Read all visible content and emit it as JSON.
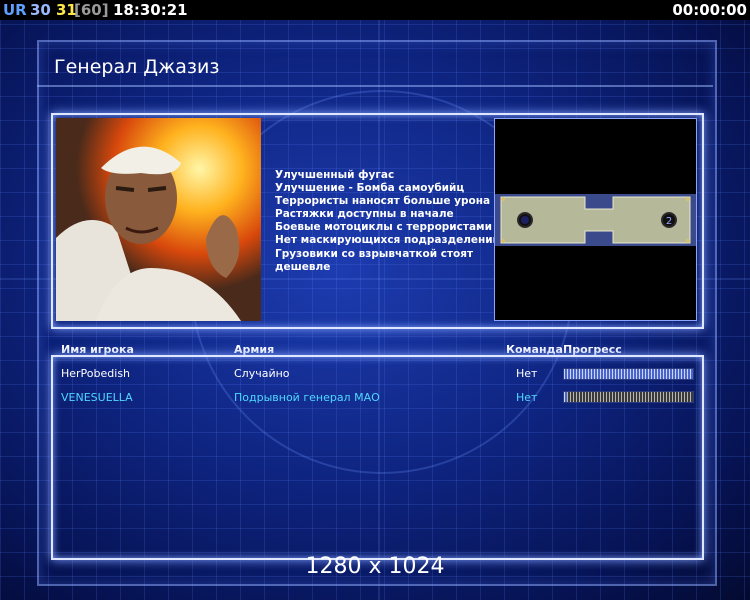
{
  "status_bar": {
    "ur_label": "UR",
    "fps_a": "30",
    "fps_b": "31",
    "fps_cap": "[60]",
    "clock": "18:30:21",
    "timer": "00:00:00"
  },
  "general": {
    "title": "Генерал Джазиз",
    "traits": [
      "Улучшенный фугас",
      "Улучшение - Бомба самоубийц",
      "Террористы наносят больше урона",
      "Растяжки доступны в начале",
      "Боевые мотоциклы с террористами",
      "Нет маскирующихся подразделений",
      "Грузовики со взрывчаткой стоят",
      " дешевле"
    ]
  },
  "minimap": {
    "start_positions": [
      "1",
      "2"
    ]
  },
  "players_table": {
    "headers": {
      "name": "Имя игрока",
      "army": "Армия",
      "team": "Команда",
      "progress": "Прогресс"
    },
    "rows": [
      {
        "name": "HerPobedish",
        "army": "Случайно",
        "team": "Нет",
        "progress": 1.0,
        "color": "#ffffff"
      },
      {
        "name": "VENESUELLA",
        "army": "Подрывной генерал МАО",
        "team": "Нет",
        "progress": 0.02,
        "color": "#4fd8ff"
      }
    ]
  },
  "resolution": "1280 x 1024"
}
